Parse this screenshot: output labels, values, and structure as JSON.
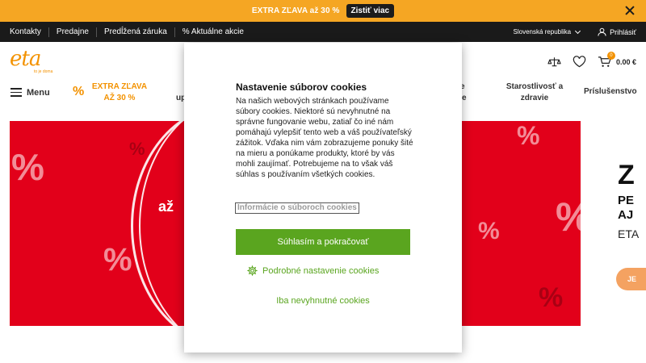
{
  "promo": {
    "text": "EXTRA ZĽAVA až 30 %",
    "button_label": "Zistiť viac"
  },
  "topnav": {
    "items": [
      "Kontakty",
      "Predajne",
      "Predĺžená záruka",
      "% Aktuálne akcie"
    ],
    "country": "Slovenská republika",
    "login": "Prihlásiť"
  },
  "header": {
    "logo": "eta",
    "logo_tagline": "to je doma",
    "cart_count": "0",
    "cart_price": "0.00 €"
  },
  "menu": {
    "label": "Menu",
    "categories": {
      "extra_line1": "EXTRA ZĽAVA",
      "extra_line2": "AŽ 30 %",
      "partial_left_top": "",
      "partial_left_bottom": "up",
      "partial_right_top": "e",
      "partial_right_bottom": "e",
      "health_line1": "Starostlivosť a",
      "health_line2": "zdravie",
      "accessories": "Príslušenstvo"
    }
  },
  "hero": {
    "az_text": "až",
    "side": {
      "big": "Z",
      "line1": "PE",
      "line2": "AJ",
      "line3": "ETA",
      "button": "JE"
    }
  },
  "cookie_modal": {
    "title": "Nastavenie súborov cookies",
    "body": "Na našich webových stránkach používame súbory cookies. Niektoré sú nevyhnutné na správne fungovanie webu, zatiaľ čo iné nám pomáhajú vylepšiť tento web a váš používateľský zážitok. Vďaka nim vám zobrazujeme ponuky šité na mieru a ponúkame produkty, ktoré by vás mohli zaujímať. Potrebujeme na to však váš súhlas s používaním všetkých cookies.",
    "info_link": "Informácie o súboroch cookies",
    "accept_button": "Súhlasím a pokračovať",
    "detail_settings": "Podrobné nastavenie cookies",
    "necessary_only": "Iba nevyhnutné cookies"
  },
  "colors": {
    "promo_bg": "#f5a623",
    "brand_orange": "#f39200",
    "hero_red": "#e2001a",
    "accept_green": "#5aa51f"
  }
}
